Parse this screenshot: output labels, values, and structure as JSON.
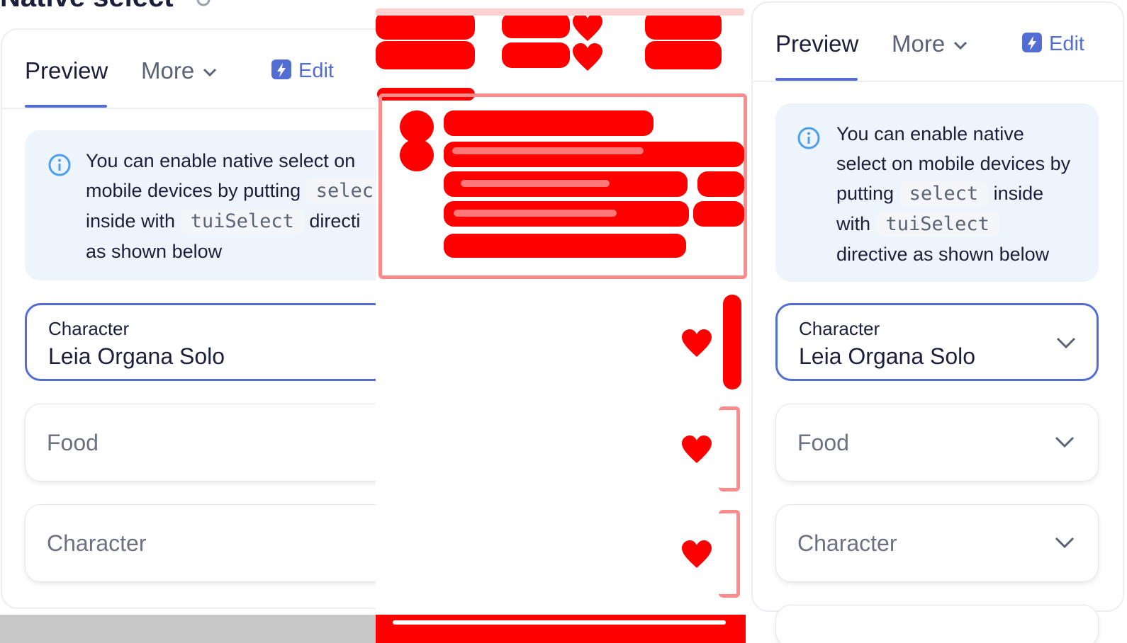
{
  "page_title": "Native select",
  "tabs": {
    "preview": "Preview",
    "more": "More",
    "edit": "Edit"
  },
  "notice": {
    "left": {
      "line1": "You can enable native select on",
      "line2_pre": "mobile devices by putting",
      "code1": "selec",
      "line3_pre": "inside with",
      "code2": "tuiSelect",
      "line3_post": "directi",
      "line4": "as shown below"
    },
    "right": {
      "line1": "You can enable native",
      "line2": "select on mobile devices by",
      "line3_pre": "putting",
      "code1": "select",
      "line3_post": "inside",
      "line4_pre": "with",
      "code2": "tuiSelect",
      "line5": "directive as shown below"
    }
  },
  "fields": {
    "character_label": "Character",
    "character_value": "Leia Organa Solo",
    "food_placeholder": "Food",
    "character_placeholder": "Character"
  },
  "colors": {
    "accent": "#526ed3",
    "notice_bg": "#edf4fc",
    "diff_red": "#ff0000"
  },
  "icons": {
    "info": "info-icon",
    "edit": "lightning-icon",
    "chevron": "chevron-down-icon",
    "heart": "heart-icon"
  }
}
